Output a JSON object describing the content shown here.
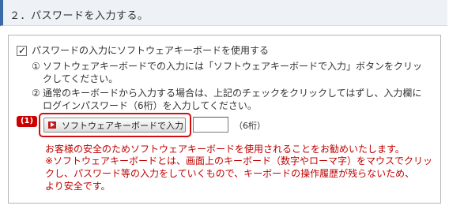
{
  "section": {
    "title": "２．パスワードを入力する。"
  },
  "form": {
    "checkbox_label": "パスワードの入力にソフトウェアキーボードを使用する",
    "checkbox_checked": true,
    "notes": [
      {
        "num": "①",
        "lines": [
          "ソフトウェアキーボードでの入力には「ソフトウェアキーボードで入力」ボタンをクリッ",
          "クしてください。"
        ]
      },
      {
        "num": "②",
        "lines": [
          "通常のキーボードから入力する場合は、上記のチェックをクリックしてはずし、入力欄に",
          "ログインパスワード（6桁）を入力してください。"
        ]
      }
    ],
    "step_badge": "(1)",
    "software_keyboard_button": "ソフトウェアキーボードで入力",
    "password_value": "",
    "password_hint": "（6桁）",
    "warning_lines": [
      "お客様の安全のためソフトウェアキーボードを使用されることをお勧めいたします。",
      "※ソフトウェアキーボードとは、画面上のキーボード（数字やローマ字）をマウスでクリッ",
      "クし、パスワード等の入力をしていくもので、キーボードの操作履歴が残らないため、",
      "より安全です。"
    ]
  },
  "colors": {
    "accent": "#3b6aa8",
    "warning": "#c00000",
    "highlight": "#d01010"
  }
}
